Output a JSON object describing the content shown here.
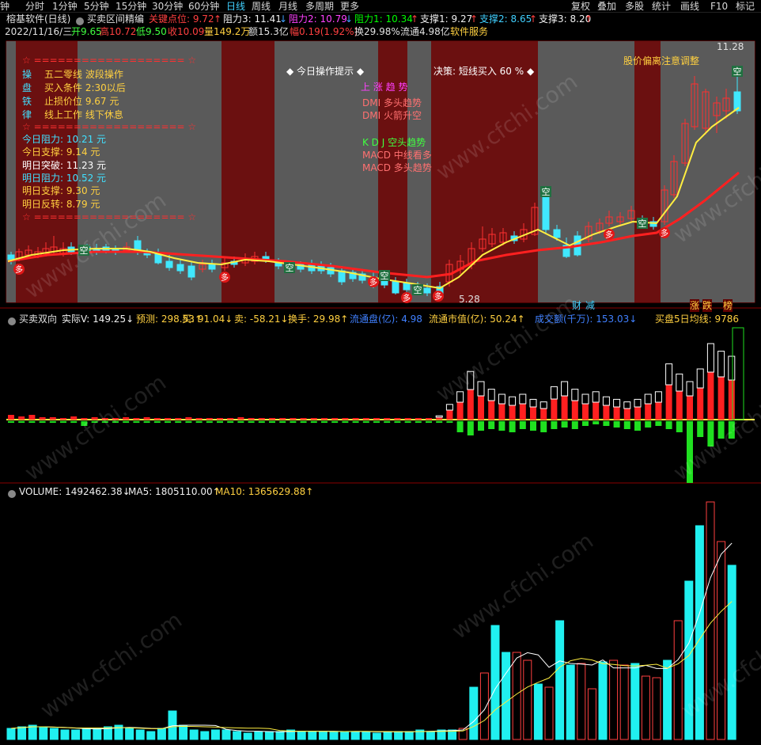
{
  "topbar": {
    "items": [
      "分时",
      "1分钟",
      "5分钟",
      "15分钟",
      "30分钟",
      "60分钟",
      "日线",
      "周线",
      "月线",
      "多周期",
      "更多"
    ],
    "right_items": [
      "复权",
      "叠加",
      "多股",
      "统计",
      "画线",
      "F10",
      "标记"
    ],
    "active": "日线"
  },
  "titlebar": {
    "software": "榕基软件(日线)",
    "indicator": "买卖区间精编",
    "levels": [
      {
        "label": "关键点位: 9.72",
        "arrow": "↑",
        "color": "#ff4040",
        "arrow_color": "#ff4040"
      },
      {
        "label": "阻力3: 11.41",
        "arrow": "↓",
        "color": "#f0f0f0",
        "arrow_color": "#40a0ff"
      },
      {
        "label": "阻力2: 10.79",
        "arrow": "↓",
        "color": "#ff40ff",
        "arrow_color": "#40a0ff"
      },
      {
        "label": "阻力1: 10.34",
        "arrow": "↑",
        "color": "#00ff00",
        "arrow_color": "#ff4040"
      },
      {
        "label": "支撑1: 9.27",
        "arrow": "↑",
        "color": "#f0f0f0",
        "arrow_color": "#ff4040"
      },
      {
        "label": "支撑2: 8.65",
        "arrow": "↑",
        "color": "#40d0ff",
        "arrow_color": "#ff4040"
      },
      {
        "label": "支撑3: 8.20",
        "arrow": "↑",
        "color": "#f0f0f0",
        "arrow_color": "#ff4040"
      }
    ]
  },
  "infobar": {
    "date": "2022/11/16/三",
    "open": "开9.65",
    "high": "高10.72",
    "low": "低9.50",
    "close": "收10.09",
    "volume": "量149.2万",
    "amount": "额15.3亿",
    "change": "幅0.19(1.92%)",
    "turnover": "换29.98%",
    "float": "流通4.98亿",
    "service": "软件服务"
  },
  "panel_left": {
    "border_top": "☆ =================== ☆",
    "border_bottom": "☆ =================== ☆",
    "rules": [
      {
        "k": "操",
        "v": "五二零线 波段操作"
      },
      {
        "k": "盘",
        "v": "买入条件 2:30以后"
      },
      {
        "k": "铁",
        "v": "止损价位 9.67 元"
      },
      {
        "k": "律",
        "v": "线上工作 线下休息"
      }
    ],
    "levels": [
      {
        "text": "今日阻力: 10.21 元",
        "color": "#40e0ff"
      },
      {
        "text": "今日支撑: 9.14 元",
        "color": "#ffd040"
      },
      {
        "text": "明日突破: 11.23 元",
        "color": "#ffffff"
      },
      {
        "text": "明日阻力: 10.52 元",
        "color": "#40e0ff"
      },
      {
        "text": "明日支撑: 9.30 元",
        "color": "#ffd040"
      },
      {
        "text": "明日反转: 8.79 元",
        "color": "#ffd040"
      }
    ]
  },
  "panel_mid": {
    "title": "◆ 今日操作提示 ◆",
    "trend": "上 涨 趋 势",
    "lines": [
      {
        "text": "DMI 多头趋势",
        "color": "#ff7070"
      },
      {
        "text": "DMI 火箭升空",
        "color": "#ff7070"
      },
      {
        "text": "K D J 空头趋势",
        "color": "#40ff40"
      },
      {
        "text": "MACD 中线看多",
        "color": "#ff7070"
      },
      {
        "text": "MACD 多头趋势",
        "color": "#ff7070"
      }
    ]
  },
  "panel_decision": {
    "text": "决策: 短线买入 60 % ◆",
    "warn": "股价偏离注意调整"
  },
  "price_labels": {
    "high": "11.28",
    "low": "5.28"
  },
  "bottom_tags": [
    "财",
    "减",
    "涨",
    "跌",
    "榜"
  ],
  "sub1": {
    "name": "买卖双向",
    "items": [
      {
        "label": "实际V: 149.25",
        "arrow": "↓",
        "color": "#f0f0f0"
      },
      {
        "label": "预测: 298.53",
        "arrow": "↑",
        "color": "#ffd040"
      },
      {
        "label": "买: 91.04",
        "arrow": "↓",
        "color": "#ffd040"
      },
      {
        "label": "卖: -58.21",
        "arrow": "↓",
        "color": "#ffd040"
      },
      {
        "label": "换手: 29.98",
        "arrow": "↑",
        "color": "#ffd040"
      },
      {
        "label": "流通盘(亿): 4.98",
        "arrow": "",
        "color": "#4080ff"
      },
      {
        "label": "流通市值(亿): 50.24",
        "arrow": "↑",
        "color": "#ffd040"
      },
      {
        "label": "成交额(千万): 153.03",
        "arrow": "↓",
        "color": "#4080ff"
      },
      {
        "label": "买盘5日均线: 9786",
        "arrow": "",
        "color": "#ffd040"
      }
    ]
  },
  "sub2": {
    "items": [
      {
        "label": "VOLUME: 1492462.38",
        "arrow": "↓",
        "color": "#f0f0f0"
      },
      {
        "label": "MA5: 1805110.00",
        "arrow": "↑",
        "color": "#f0f0f0"
      },
      {
        "label": "MA10: 1365629.88",
        "arrow": "↑",
        "color": "#ffd040"
      }
    ]
  },
  "watermark": "www.cfchi.com"
}
